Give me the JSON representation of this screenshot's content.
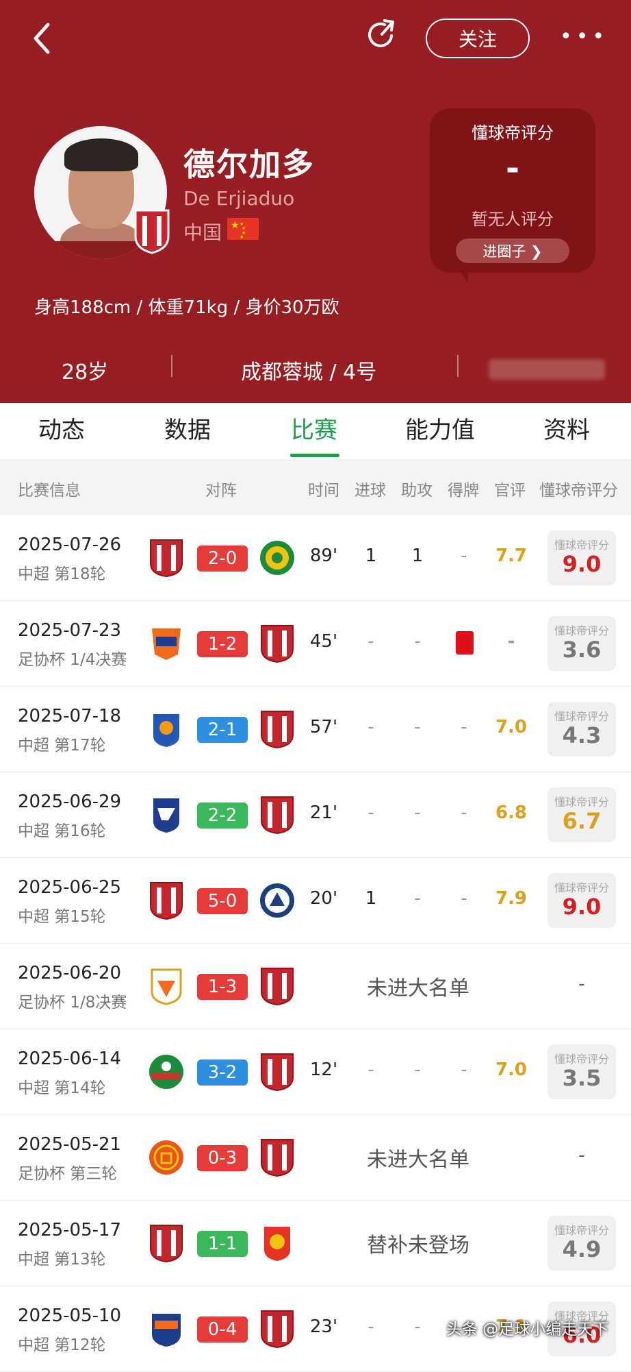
{
  "topbar": {
    "follow_label": "关注",
    "more_label": "•••"
  },
  "player": {
    "name_cn": "德尔加多",
    "name_en": "De Erjiaduo",
    "nation": "中国",
    "stats": "身高188cm / 体重71kg / 身价30万欧",
    "age": "28岁",
    "club": "成都蓉城 / 4号"
  },
  "rating_box": {
    "title": "懂球帝评分",
    "value": "-",
    "none": "暂无人评分",
    "button": "进圈子 ❯"
  },
  "tabs": [
    "动态",
    "数据",
    "比赛",
    "能力值",
    "资料"
  ],
  "active_tab": "比赛",
  "columns": [
    "比赛信息",
    "对阵",
    "时间",
    "进球",
    "助攻",
    "得牌",
    "官评",
    "懂球帝评分"
  ],
  "rating_label": "懂球帝评分",
  "matches": [
    {
      "date": "2025-07-26",
      "comp": "中超 第18轮",
      "score": "2-0",
      "score_color": "red",
      "minute": "89'",
      "goal": "1",
      "assist": "1",
      "card": "-",
      "official": "7.7",
      "rating": "9.0",
      "rating_color": "red"
    },
    {
      "date": "2025-07-23",
      "comp": "足协杯 1/4决赛",
      "score": "1-2",
      "score_color": "red",
      "minute": "45'",
      "goal": "-",
      "assist": "-",
      "card": "red",
      "official": "-",
      "rating": "3.6",
      "rating_color": "grey"
    },
    {
      "date": "2025-07-18",
      "comp": "中超 第17轮",
      "score": "2-1",
      "score_color": "blue",
      "minute": "57'",
      "goal": "-",
      "assist": "-",
      "card": "-",
      "official": "7.0",
      "rating": "4.3",
      "rating_color": "grey"
    },
    {
      "date": "2025-06-29",
      "comp": "中超 第16轮",
      "score": "2-2",
      "score_color": "green",
      "minute": "21'",
      "goal": "-",
      "assist": "-",
      "card": "-",
      "official": "6.8",
      "rating": "6.7",
      "rating_color": "gold"
    },
    {
      "date": "2025-06-25",
      "comp": "中超 第15轮",
      "score": "5-0",
      "score_color": "red",
      "minute": "20'",
      "goal": "1",
      "assist": "-",
      "card": "-",
      "official": "7.9",
      "rating": "9.0",
      "rating_color": "red"
    },
    {
      "date": "2025-06-20",
      "comp": "足协杯 1/8决赛",
      "score": "1-3",
      "score_color": "red",
      "note": "未进大名单",
      "rating_dash": "-"
    },
    {
      "date": "2025-06-14",
      "comp": "中超 第14轮",
      "score": "3-2",
      "score_color": "blue",
      "minute": "12'",
      "goal": "-",
      "assist": "-",
      "card": "-",
      "official": "7.0",
      "rating": "3.5",
      "rating_color": "grey"
    },
    {
      "date": "2025-05-21",
      "comp": "足协杯 第三轮",
      "score": "0-3",
      "score_color": "red",
      "note": "未进大名单",
      "rating_dash": "-"
    },
    {
      "date": "2025-05-17",
      "comp": "中超 第13轮",
      "score": "1-1",
      "score_color": "green",
      "note": "替补未登场",
      "rating": "4.9",
      "rating_color": "grey"
    },
    {
      "date": "2025-05-10",
      "comp": "中超 第12轮",
      "score": "0-4",
      "score_color": "red",
      "minute": "23'",
      "goal": "-",
      "assist": "-",
      "card": "-",
      "official": "7.1",
      "rating": "6.0",
      "rating_color": "red"
    }
  ],
  "watermark": "头条 @足球小编走天下",
  "colors": {
    "header": "#961d21",
    "accent": "#1a9e4a",
    "gold": "#d9a21a",
    "red": "#d42020"
  }
}
